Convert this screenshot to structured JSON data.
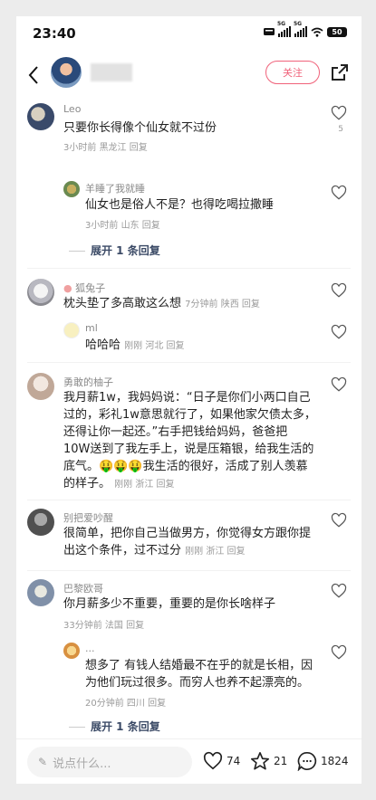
{
  "status_bar": {
    "time": "23:40",
    "battery": "50",
    "sim1": "5G",
    "sim2": "5G"
  },
  "header": {
    "follow_label": "关注"
  },
  "comments": [
    {
      "user": "Leo",
      "text": "只要你长得像个仙女就不过份",
      "time": "3小时前",
      "location": "黑龙江",
      "reply_label": "回复",
      "likes": "5"
    },
    {
      "user": "羊睡了我就睡",
      "text": "仙女也是俗人不是？也得吃喝拉撒睡",
      "time": "3小时前",
      "location": "山东",
      "reply_label": "回复"
    },
    {
      "user": "狐兔子",
      "text": "枕头垫了多高敢这么想",
      "time": "7分钟前",
      "location": "陕西",
      "reply_label": "回复"
    },
    {
      "user": "ml",
      "text": "哈哈哈",
      "time": "刚刚",
      "location": "河北",
      "reply_label": "回复"
    },
    {
      "user": "勇敢的柚子",
      "text_lines": [
        "我月薪1w，我妈妈说：“日子是你们小两口自己",
        "过的，彩礼1w意思就行了，如果他家欠债太多，",
        "还得让你一起还。”右手把钱给妈妈，爸爸把",
        "10W送到了我左手上，说是压箱银，给我生活的",
        "底气。",
        "我生活的很好，活成了别人羡慕",
        "的样子。"
      ],
      "emoji": "🤑🤑🤑",
      "time": "刚刚",
      "location": "浙江",
      "reply_label": "回复"
    },
    {
      "user": "别把爱吵醒",
      "text_lines": [
        "很简单，把你自己当做男方，你觉得女方跟你提",
        "出这个条件，过不过分"
      ],
      "time": "刚刚",
      "location": "浙江",
      "reply_label": "回复"
    },
    {
      "user": "巴黎欧哥",
      "text": "你月薪多少不重要，重要的是你长啥样子",
      "time": "33分钟前",
      "location": "法国",
      "reply_label": "回复"
    },
    {
      "user": "...",
      "text_lines": [
        "想多了 有钱人结婚最不在乎的就是长相，因",
        "为他们玩过很多。而穷人也养不起漂亮的。"
      ],
      "time": "20分钟前",
      "location": "四川",
      "reply_label": "回复"
    }
  ],
  "expand_label": "展开 1 条回复",
  "bottom_bar": {
    "input_placeholder": "说点什么...",
    "likes": "74",
    "favorites": "21",
    "comments": "1824"
  },
  "icons": {
    "back": "back-arrow-icon",
    "share": "share-icon",
    "like": "heart-icon",
    "star": "star-icon",
    "comment": "comment-icon",
    "pen": "pen-icon"
  },
  "colors": {
    "accent": "#f0627a",
    "expand": "#3b4a66",
    "meta": "#9a9a9a"
  }
}
